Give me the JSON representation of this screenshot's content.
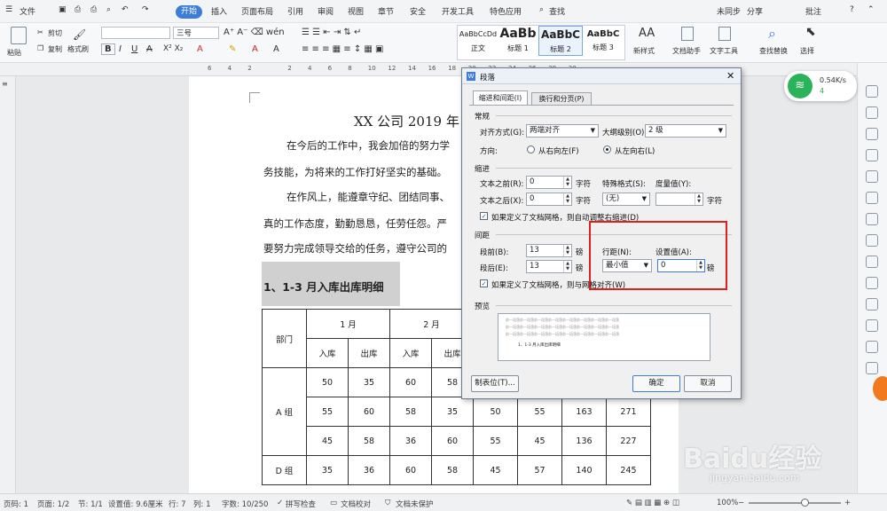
{
  "menubar": {
    "file": "文件",
    "tabs": [
      "开始",
      "插入",
      "页面布局",
      "引用",
      "审阅",
      "视图",
      "章节",
      "安全",
      "开发工具",
      "特色应用"
    ],
    "search": "查找",
    "sync": "未同步",
    "share": "分享",
    "comment": "批注",
    "help": "?"
  },
  "ribbon": {
    "paste": "粘贴",
    "cut": "剪切",
    "copy": "复制",
    "format_painter": "格式刷",
    "font_size": "三号",
    "styles": [
      {
        "preview": "AaBbCcDd",
        "name": "正文"
      },
      {
        "preview": "AaBb",
        "name": "标题 1"
      },
      {
        "preview": "AaBbC",
        "name": "标题 2"
      },
      {
        "preview": "AaBbC",
        "name": "标题 3"
      }
    ],
    "new_style": "新样式",
    "doc_assistant": "文档助手",
    "text_tools": "文字工具",
    "find_replace": "查找替换",
    "select": "选择"
  },
  "ruler": {
    "ticks": [
      "6",
      "4",
      "2",
      "",
      "2",
      "4",
      "6",
      "8",
      "10",
      "12",
      "14",
      "16",
      "18",
      "20",
      "22",
      "24",
      "26",
      "28",
      "30"
    ]
  },
  "document": {
    "title": "XX 公司 2019 年",
    "paragraphs": [
      "在今后的工作中，我会加倍的努力学",
      "务技能，为将来的工作打好坚实的基础。",
      "在作风上，能遵章守纪、团结同事、",
      "真的工作态度，勤勤恳恳，任劳任怨。严",
      "要努力完成领导交给的任务，遵守公司的"
    ],
    "heading": "1、1-3 月入库出库明细",
    "table": {
      "header_dept": "部门",
      "months": [
        "1 月",
        "2 月"
      ],
      "sub": [
        "入库",
        "出库",
        "入库",
        "出库"
      ],
      "rows": [
        {
          "dept": "A 组",
          "values": [
            [
              "50",
              "35",
              "60",
              "58",
              "",
              "",
              "",
              ""
            ],
            [
              "55",
              "60",
              "58",
              "35",
              "50",
              "55",
              "163",
              "271"
            ],
            [
              "45",
              "58",
              "36",
              "60",
              "55",
              "45",
              "136",
              "227"
            ]
          ]
        },
        {
          "dept": "D 组",
          "values": [
            [
              "35",
              "36",
              "60",
              "58",
              "45",
              "57",
              "140",
              "245"
            ]
          ]
        }
      ]
    }
  },
  "dialog": {
    "title": "段落",
    "tabs": [
      "缩进和间距(I)",
      "换行和分页(P)"
    ],
    "general": "常规",
    "alignment_label": "对齐方式(G):",
    "alignment_value": "两端对齐",
    "outline_label": "大纲级别(O):",
    "outline_value": "2 级",
    "direction_label": "方向:",
    "rtl": "从右向左(F)",
    "ltr": "从左向右(L)",
    "indent": "缩进",
    "before_text_label": "文本之前(R):",
    "before_text_value": "0",
    "after_text_label": "文本之后(X):",
    "after_text_value": "0",
    "unit_char": "字符",
    "special_label": "特殊格式(S):",
    "special_value": "(无)",
    "measure_label": "度量值(Y):",
    "measure_unit": "字符",
    "auto_indent_check": "如果定义了文档网格，则自动调整右缩进(D)",
    "spacing": "间距",
    "before_label": "段前(B):",
    "before_value": "13",
    "after_label": "段后(E):",
    "after_value": "13",
    "unit_pound": "磅",
    "line_spacing_label": "行距(N):",
    "line_spacing_value": "最小值",
    "set_value_label": "设置值(A):",
    "set_value": "0",
    "grid_align_check": "如果定义了文档网格，则与网格对齐(W)",
    "preview": "预览",
    "preview_line": "前一段落前一段落前一段落前一段落前一段落前一段落前一段落前一段落",
    "preview_heading": "1、1-3 月入库出库明细",
    "tabs_btn": "制表位(T)...",
    "ok": "确定",
    "cancel": "取消"
  },
  "network": {
    "speed": "0.54K/s",
    "count": "4"
  },
  "statusbar": {
    "page": "页码: 1",
    "pages": "页面: 1/2",
    "section": "节: 1/1",
    "setting": "设置值: 9.6厘米",
    "row": "行: 7",
    "col": "列: 1",
    "words": "字数: 10/250",
    "spell": "拼写检查",
    "proof": "文档校对",
    "protect": "文档未保护",
    "zoom": "100%"
  },
  "watermark": {
    "brand": "Baidu经验",
    "url": "jingyan.baidu.com"
  },
  "colors": {
    "accent": "#3b7dd8",
    "highlight": "#e02020",
    "heading_bg": "#d0d0d0"
  }
}
